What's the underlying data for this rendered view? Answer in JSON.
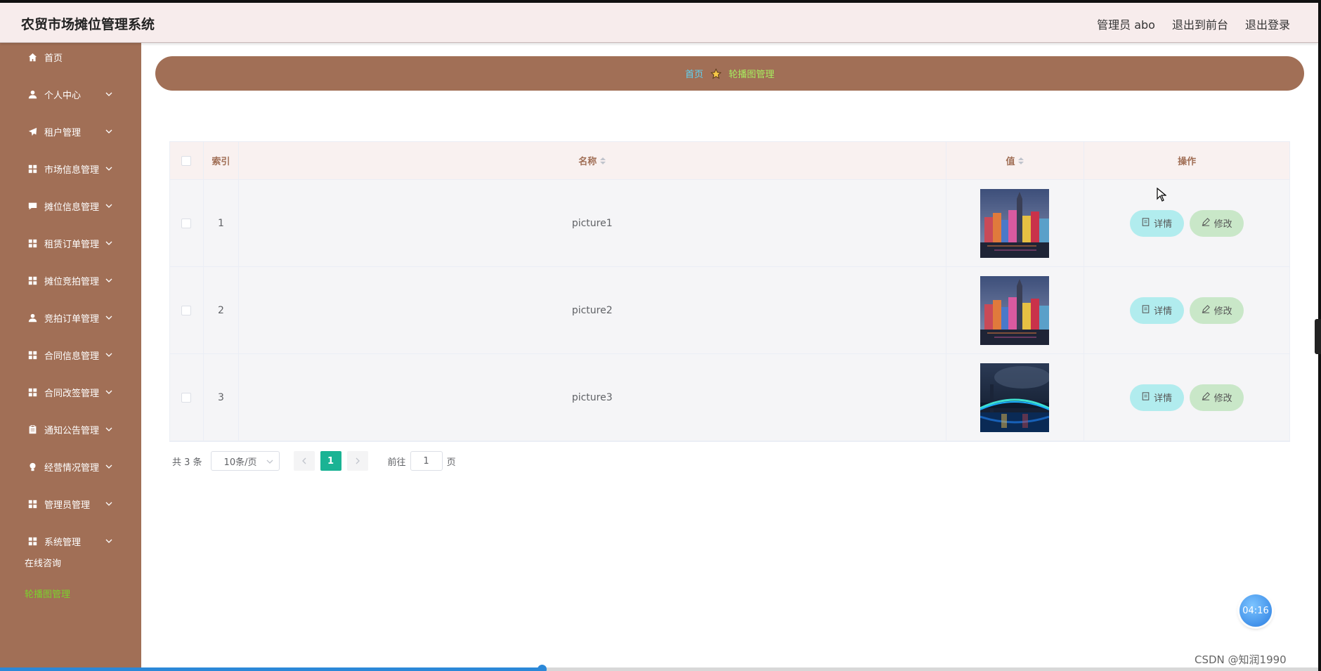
{
  "header": {
    "title": "农贸市场摊位管理系统",
    "admin": "管理员 abo",
    "to_front": "退出到前台",
    "logout": "退出登录"
  },
  "sidebar": {
    "items": [
      {
        "label": "首页",
        "icon": "home-icon",
        "has_chevron": false
      },
      {
        "label": "个人中心",
        "icon": "user-icon",
        "has_chevron": true
      },
      {
        "label": "租户管理",
        "icon": "send-icon",
        "has_chevron": true
      },
      {
        "label": "市场信息管理",
        "icon": "grid-icon",
        "has_chevron": true
      },
      {
        "label": "摊位信息管理",
        "icon": "chat-icon",
        "has_chevron": true
      },
      {
        "label": "租赁订单管理",
        "icon": "grid-icon",
        "has_chevron": true
      },
      {
        "label": "摊位竞拍管理",
        "icon": "grid-icon",
        "has_chevron": true
      },
      {
        "label": "竞拍订单管理",
        "icon": "user-icon",
        "has_chevron": true
      },
      {
        "label": "合同信息管理",
        "icon": "grid-icon",
        "has_chevron": true
      },
      {
        "label": "合同改签管理",
        "icon": "grid-icon",
        "has_chevron": true
      },
      {
        "label": "通知公告管理",
        "icon": "clipboard-icon",
        "has_chevron": true
      },
      {
        "label": "经营情况管理",
        "icon": "bulb-icon",
        "has_chevron": true
      },
      {
        "label": "管理员管理",
        "icon": "grid-icon",
        "has_chevron": true
      },
      {
        "label": "系统管理",
        "icon": "grid-icon",
        "has_chevron": true
      }
    ],
    "consult": "在线咨询",
    "carousel": "轮播图管理"
  },
  "breadcrumb": {
    "home": "首页",
    "current": "轮播图管理"
  },
  "table": {
    "headers": {
      "index": "索引",
      "name": "名称",
      "value": "值",
      "ops": "操作"
    },
    "rows": [
      {
        "index": "1",
        "name": "picture1",
        "image": "colorful-buildings-night"
      },
      {
        "index": "2",
        "name": "picture2",
        "image": "colorful-buildings-night"
      },
      {
        "index": "3",
        "name": "picture3",
        "image": "lit-bridge-night"
      }
    ],
    "detail_label": "详情",
    "edit_label": "修改"
  },
  "pagination": {
    "total": "共 3 条",
    "page_size": "10条/页",
    "current_page": "1",
    "goto_label": "前往",
    "goto_value": "1",
    "page_suffix": "页"
  },
  "overlay": {
    "timer": "04:16",
    "watermark": "CSDN @知润1990",
    "video_progress": 0.41
  },
  "colors": {
    "sidebar": "#a16f56",
    "header": "#f7ecec",
    "accent_green": "#1ab394",
    "detail_btn": "#b1ecee",
    "edit_btn": "#c9e7c8"
  }
}
